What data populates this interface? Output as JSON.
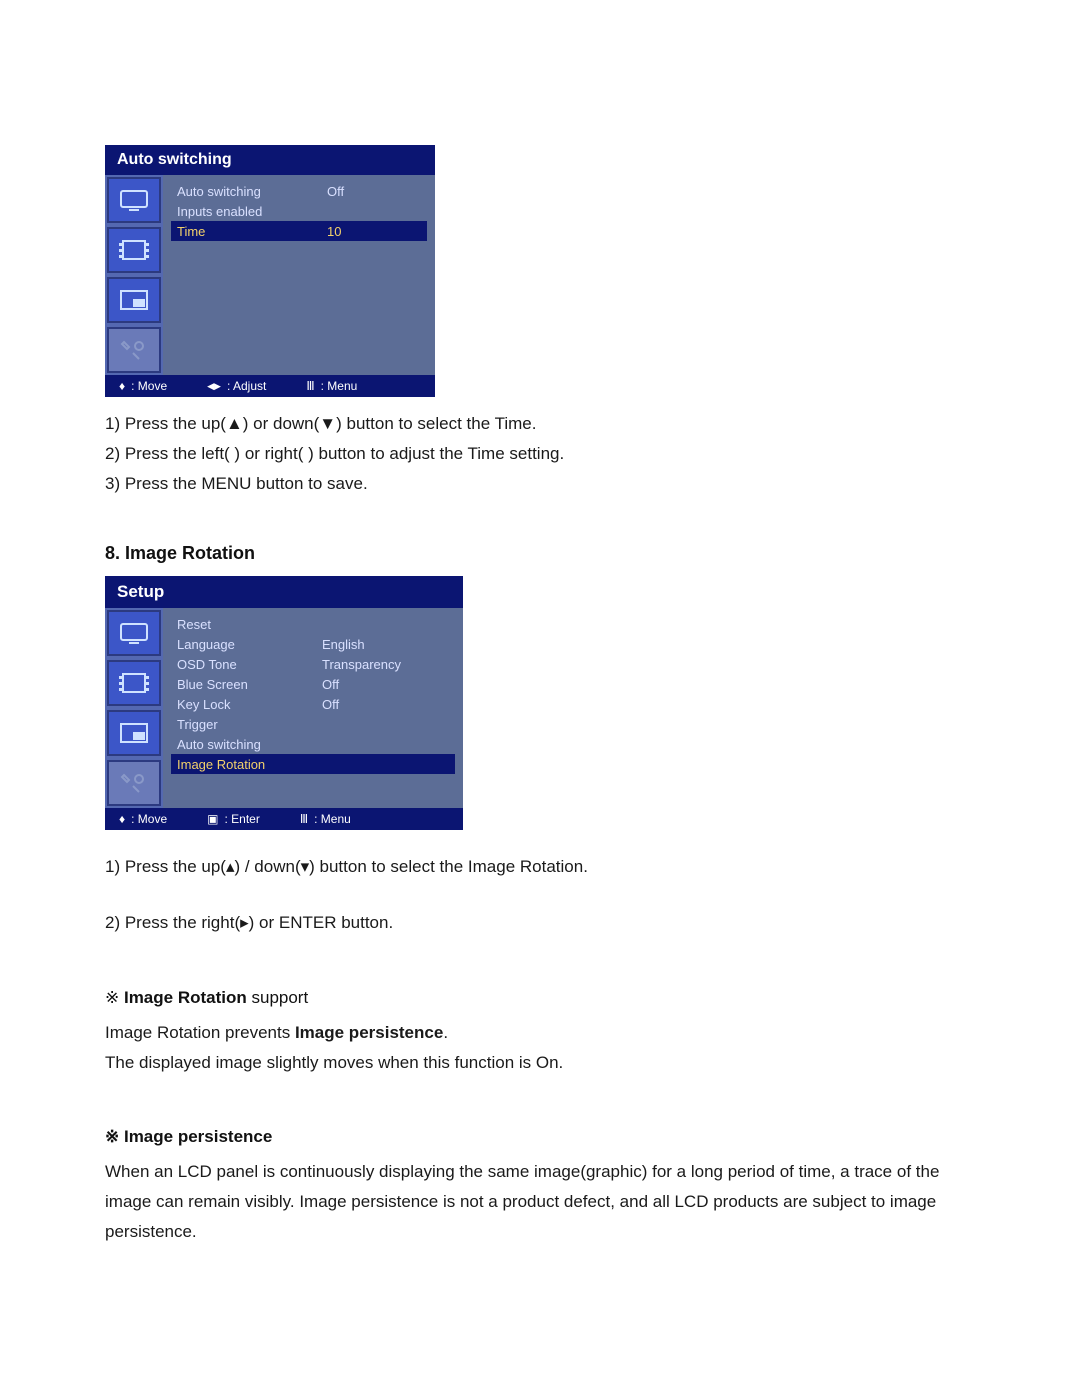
{
  "osd1": {
    "title": "Auto switching",
    "rows": [
      {
        "label": "Auto switching",
        "value": "Off",
        "selected": false
      },
      {
        "label": "Inputs enabled",
        "value": "",
        "selected": false
      },
      {
        "label": "Time",
        "value": "10",
        "selected": true
      }
    ],
    "footer": {
      "move": ": Move",
      "adjust": ": Adjust",
      "menu": ": Menu"
    }
  },
  "instr1": {
    "l1": "1) Press the up(▲) or down(▼) button to select the Time.",
    "l2": "2) Press the left(  ) or right(  ) button to adjust the Time setting.",
    "l3": "3) Press the MENU button to save."
  },
  "section2_title": "8. Image Rotation",
  "osd2": {
    "title": "Setup",
    "rows": [
      {
        "label": "Reset",
        "value": "",
        "selected": false
      },
      {
        "label": "Language",
        "value": "English",
        "selected": false
      },
      {
        "label": "OSD Tone",
        "value": "Transparency",
        "selected": false
      },
      {
        "label": "Blue Screen",
        "value": "Off",
        "selected": false
      },
      {
        "label": "Key Lock",
        "value": "Off",
        "selected": false
      },
      {
        "label": "Trigger",
        "value": "",
        "selected": false
      },
      {
        "label": "Auto switching",
        "value": "",
        "selected": false
      },
      {
        "label": "Image Rotation",
        "value": "",
        "selected": true
      }
    ],
    "footer": {
      "move": ": Move",
      "enter": ": Enter",
      "menu": ": Menu"
    }
  },
  "instr2": {
    "l1": "1) Press the up(▴) / down(▾) button to select the Image Rotation.",
    "l2": "2) Press the right(▸) or ENTER button."
  },
  "note1": {
    "head_pre": "※  ",
    "head_bold": "Image Rotation",
    "head_post": " support",
    "p1_pre": "Image Rotation prevents ",
    "p1_bold": "Image persistence",
    "p1_post": ".",
    "p2": "The displayed image slightly moves when this function is On."
  },
  "note2": {
    "head": "※  Image persistence",
    "p": "When an LCD panel is continuously displaying the same image(graphic) for a long period of time, a trace of the image can remain visibly. Image persistence is not a product defect, and all LCD products are subject to image persistence."
  },
  "glyphs": {
    "updown": "♦",
    "leftright": "◀▶",
    "square": "▣",
    "menu": "Ⅲ"
  }
}
